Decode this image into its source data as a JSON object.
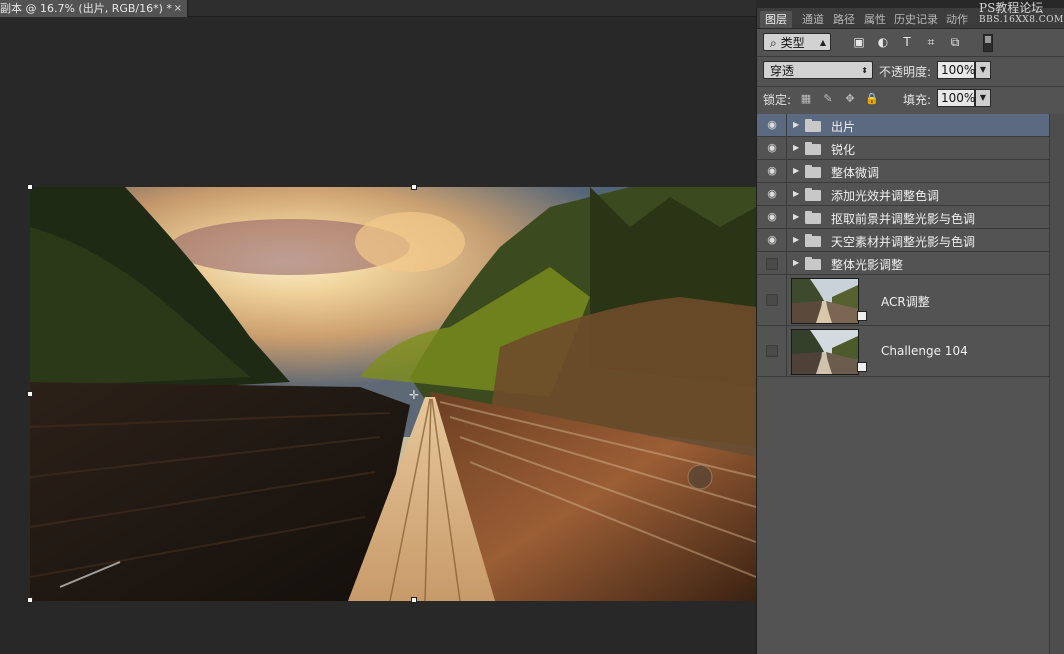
{
  "document": {
    "tab_title": "副本 @ 16.7% (出片, RGB/16*) *",
    "close_symbol": "×"
  },
  "panel": {
    "tabs": [
      "图层",
      "通道",
      "路径",
      "属性",
      "历史记录",
      "动作"
    ],
    "active_tab": "图层",
    "watermark": {
      "line1": "PS教程论坛",
      "line2": "BBS.16XX8.COM"
    },
    "filter": {
      "kind_label": "类型",
      "search_icon": "⌕"
    },
    "blend_mode": "穿透",
    "opacity_label": "不透明度:",
    "opacity_value": "100%",
    "lock_label": "锁定:",
    "fill_label": "填充:",
    "fill_value": "100%"
  },
  "layers": [
    {
      "name": "出片",
      "type": "group",
      "visible": true,
      "selected": true
    },
    {
      "name": "锐化",
      "type": "group",
      "visible": true,
      "selected": false
    },
    {
      "name": "整体微调",
      "type": "group",
      "visible": true,
      "selected": false
    },
    {
      "name": "添加光效并调整色调",
      "type": "group",
      "visible": true,
      "selected": false
    },
    {
      "name": "抠取前景并调整光影与色调",
      "type": "group",
      "visible": true,
      "selected": false
    },
    {
      "name": "天空素材并调整光影与色调",
      "type": "group",
      "visible": true,
      "selected": false
    },
    {
      "name": "整体光影调整",
      "type": "group",
      "visible": false,
      "selected": false
    },
    {
      "name": "ACR调整",
      "type": "smart-object",
      "visible": false,
      "selected": false
    },
    {
      "name": "Challenge 104",
      "type": "smart-object",
      "visible": false,
      "selected": false
    }
  ],
  "colors": {
    "panel_bg": "#535353",
    "canvas_bg": "#282828",
    "selected_layer": "#5b6a80"
  }
}
